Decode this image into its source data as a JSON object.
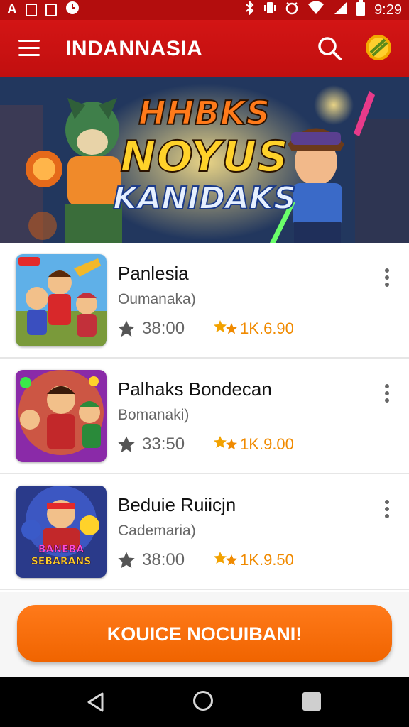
{
  "status_bar": {
    "left_glyph": "A",
    "time": "9:29"
  },
  "app_bar": {
    "title": "INDANNASIA",
    "icons": [
      "menu-icon",
      "search-icon",
      "coin-icon"
    ]
  },
  "banner": {
    "lines": [
      "HHBKS",
      "NOYUS",
      "KANIDAKS"
    ]
  },
  "games": [
    {
      "title": "Panlesia",
      "subtitle": "Oumanaka)",
      "score": "38:00",
      "downloads": "1K.6.90"
    },
    {
      "title": "Palhaks Bondecan",
      "subtitle": "Bomanaki)",
      "score": "33:50",
      "downloads": "1K.9.00"
    },
    {
      "title": "Beduie Ruiicjn",
      "subtitle": "Cademaria)",
      "score": "38:00",
      "downloads": "1K.9.50"
    }
  ],
  "thumb3_text": [
    "BANEBA",
    "SEBARANS"
  ],
  "cta": {
    "label": "KOUICE NOCUIBANI!"
  },
  "colors": {
    "primary_red": "#c9120f",
    "accent_orange": "#f06a00",
    "rating_orange": "#f08a00"
  }
}
